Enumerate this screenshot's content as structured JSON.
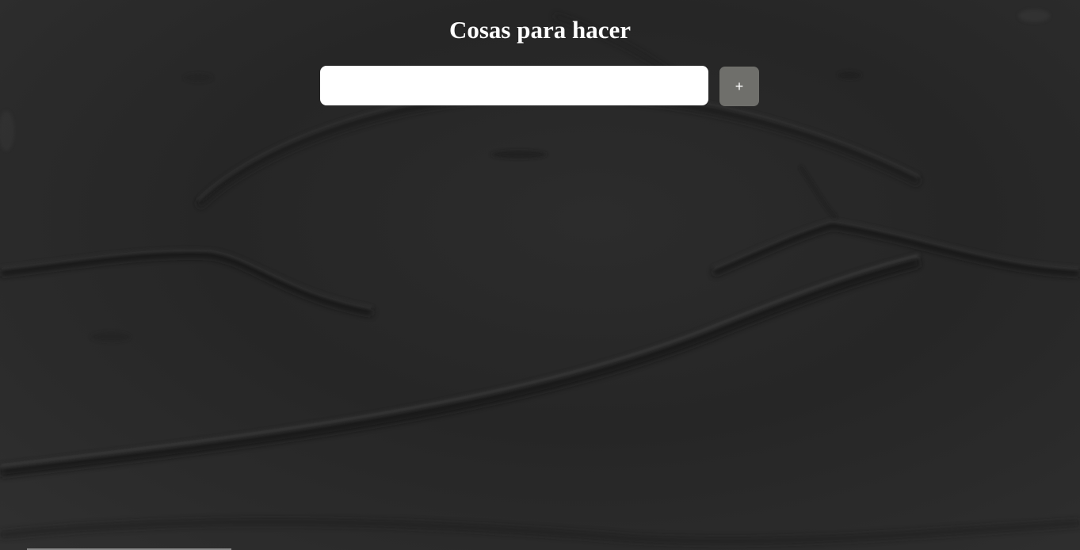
{
  "page": {
    "title": "Cosas para hacer"
  },
  "form": {
    "input_value": "",
    "input_placeholder": "",
    "add_button_label": "+"
  },
  "colors": {
    "background": "#2a2a2a",
    "title_text": "#ffffff",
    "input_background": "#ffffff",
    "add_button_background": "#6f6f6b",
    "add_button_text": "#ffffff"
  }
}
